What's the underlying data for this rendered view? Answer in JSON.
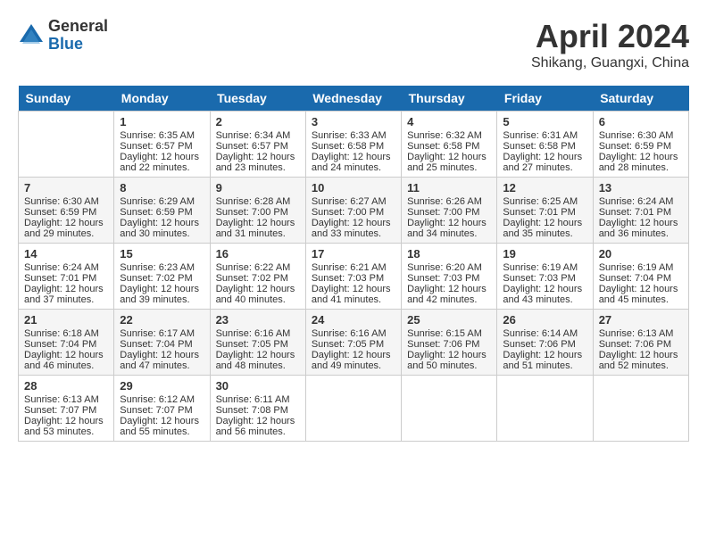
{
  "header": {
    "logo_general": "General",
    "logo_blue": "Blue",
    "month_title": "April 2024",
    "location": "Shikang, Guangxi, China"
  },
  "days_of_week": [
    "Sunday",
    "Monday",
    "Tuesday",
    "Wednesday",
    "Thursday",
    "Friday",
    "Saturday"
  ],
  "weeks": [
    {
      "shaded": false,
      "days": [
        {
          "num": "",
          "sunrise": "",
          "sunset": "",
          "daylight": ""
        },
        {
          "num": "1",
          "sunrise": "Sunrise: 6:35 AM",
          "sunset": "Sunset: 6:57 PM",
          "daylight": "Daylight: 12 hours and 22 minutes."
        },
        {
          "num": "2",
          "sunrise": "Sunrise: 6:34 AM",
          "sunset": "Sunset: 6:57 PM",
          "daylight": "Daylight: 12 hours and 23 minutes."
        },
        {
          "num": "3",
          "sunrise": "Sunrise: 6:33 AM",
          "sunset": "Sunset: 6:58 PM",
          "daylight": "Daylight: 12 hours and 24 minutes."
        },
        {
          "num": "4",
          "sunrise": "Sunrise: 6:32 AM",
          "sunset": "Sunset: 6:58 PM",
          "daylight": "Daylight: 12 hours and 25 minutes."
        },
        {
          "num": "5",
          "sunrise": "Sunrise: 6:31 AM",
          "sunset": "Sunset: 6:58 PM",
          "daylight": "Daylight: 12 hours and 27 minutes."
        },
        {
          "num": "6",
          "sunrise": "Sunrise: 6:30 AM",
          "sunset": "Sunset: 6:59 PM",
          "daylight": "Daylight: 12 hours and 28 minutes."
        }
      ]
    },
    {
      "shaded": true,
      "days": [
        {
          "num": "7",
          "sunrise": "Sunrise: 6:30 AM",
          "sunset": "Sunset: 6:59 PM",
          "daylight": "Daylight: 12 hours and 29 minutes."
        },
        {
          "num": "8",
          "sunrise": "Sunrise: 6:29 AM",
          "sunset": "Sunset: 6:59 PM",
          "daylight": "Daylight: 12 hours and 30 minutes."
        },
        {
          "num": "9",
          "sunrise": "Sunrise: 6:28 AM",
          "sunset": "Sunset: 7:00 PM",
          "daylight": "Daylight: 12 hours and 31 minutes."
        },
        {
          "num": "10",
          "sunrise": "Sunrise: 6:27 AM",
          "sunset": "Sunset: 7:00 PM",
          "daylight": "Daylight: 12 hours and 33 minutes."
        },
        {
          "num": "11",
          "sunrise": "Sunrise: 6:26 AM",
          "sunset": "Sunset: 7:00 PM",
          "daylight": "Daylight: 12 hours and 34 minutes."
        },
        {
          "num": "12",
          "sunrise": "Sunrise: 6:25 AM",
          "sunset": "Sunset: 7:01 PM",
          "daylight": "Daylight: 12 hours and 35 minutes."
        },
        {
          "num": "13",
          "sunrise": "Sunrise: 6:24 AM",
          "sunset": "Sunset: 7:01 PM",
          "daylight": "Daylight: 12 hours and 36 minutes."
        }
      ]
    },
    {
      "shaded": false,
      "days": [
        {
          "num": "14",
          "sunrise": "Sunrise: 6:24 AM",
          "sunset": "Sunset: 7:01 PM",
          "daylight": "Daylight: 12 hours and 37 minutes."
        },
        {
          "num": "15",
          "sunrise": "Sunrise: 6:23 AM",
          "sunset": "Sunset: 7:02 PM",
          "daylight": "Daylight: 12 hours and 39 minutes."
        },
        {
          "num": "16",
          "sunrise": "Sunrise: 6:22 AM",
          "sunset": "Sunset: 7:02 PM",
          "daylight": "Daylight: 12 hours and 40 minutes."
        },
        {
          "num": "17",
          "sunrise": "Sunrise: 6:21 AM",
          "sunset": "Sunset: 7:03 PM",
          "daylight": "Daylight: 12 hours and 41 minutes."
        },
        {
          "num": "18",
          "sunrise": "Sunrise: 6:20 AM",
          "sunset": "Sunset: 7:03 PM",
          "daylight": "Daylight: 12 hours and 42 minutes."
        },
        {
          "num": "19",
          "sunrise": "Sunrise: 6:19 AM",
          "sunset": "Sunset: 7:03 PM",
          "daylight": "Daylight: 12 hours and 43 minutes."
        },
        {
          "num": "20",
          "sunrise": "Sunrise: 6:19 AM",
          "sunset": "Sunset: 7:04 PM",
          "daylight": "Daylight: 12 hours and 45 minutes."
        }
      ]
    },
    {
      "shaded": true,
      "days": [
        {
          "num": "21",
          "sunrise": "Sunrise: 6:18 AM",
          "sunset": "Sunset: 7:04 PM",
          "daylight": "Daylight: 12 hours and 46 minutes."
        },
        {
          "num": "22",
          "sunrise": "Sunrise: 6:17 AM",
          "sunset": "Sunset: 7:04 PM",
          "daylight": "Daylight: 12 hours and 47 minutes."
        },
        {
          "num": "23",
          "sunrise": "Sunrise: 6:16 AM",
          "sunset": "Sunset: 7:05 PM",
          "daylight": "Daylight: 12 hours and 48 minutes."
        },
        {
          "num": "24",
          "sunrise": "Sunrise: 6:16 AM",
          "sunset": "Sunset: 7:05 PM",
          "daylight": "Daylight: 12 hours and 49 minutes."
        },
        {
          "num": "25",
          "sunrise": "Sunrise: 6:15 AM",
          "sunset": "Sunset: 7:06 PM",
          "daylight": "Daylight: 12 hours and 50 minutes."
        },
        {
          "num": "26",
          "sunrise": "Sunrise: 6:14 AM",
          "sunset": "Sunset: 7:06 PM",
          "daylight": "Daylight: 12 hours and 51 minutes."
        },
        {
          "num": "27",
          "sunrise": "Sunrise: 6:13 AM",
          "sunset": "Sunset: 7:06 PM",
          "daylight": "Daylight: 12 hours and 52 minutes."
        }
      ]
    },
    {
      "shaded": false,
      "days": [
        {
          "num": "28",
          "sunrise": "Sunrise: 6:13 AM",
          "sunset": "Sunset: 7:07 PM",
          "daylight": "Daylight: 12 hours and 53 minutes."
        },
        {
          "num": "29",
          "sunrise": "Sunrise: 6:12 AM",
          "sunset": "Sunset: 7:07 PM",
          "daylight": "Daylight: 12 hours and 55 minutes."
        },
        {
          "num": "30",
          "sunrise": "Sunrise: 6:11 AM",
          "sunset": "Sunset: 7:08 PM",
          "daylight": "Daylight: 12 hours and 56 minutes."
        },
        {
          "num": "",
          "sunrise": "",
          "sunset": "",
          "daylight": ""
        },
        {
          "num": "",
          "sunrise": "",
          "sunset": "",
          "daylight": ""
        },
        {
          "num": "",
          "sunrise": "",
          "sunset": "",
          "daylight": ""
        },
        {
          "num": "",
          "sunrise": "",
          "sunset": "",
          "daylight": ""
        }
      ]
    }
  ]
}
